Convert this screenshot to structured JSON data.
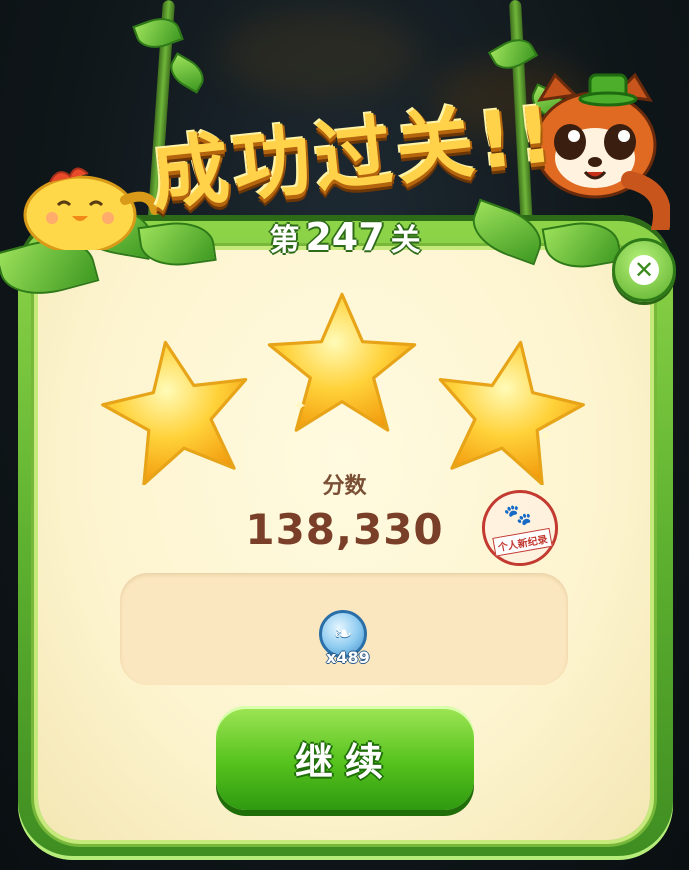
{
  "dialog": {
    "title": "成功过关!!",
    "level_prefix": "第",
    "level_number": "247",
    "level_suffix": "关",
    "stars_earned": 3,
    "stars_total": 3
  },
  "score": {
    "label": "分数",
    "value": "138,330",
    "record_stamp": "个人新纪录"
  },
  "reward": {
    "item_icon": "leaf-coin-icon",
    "count": "x489"
  },
  "buttons": {
    "continue_label": "继续",
    "close_icon": "close-icon"
  },
  "colors": {
    "panel_green": "#5fb230",
    "panel_cream": "#fdf4cf",
    "star_gold": "#ffd23a",
    "score_brown": "#7a3f28",
    "button_green": "#55c21d",
    "stamp_red": "#c23a30"
  }
}
